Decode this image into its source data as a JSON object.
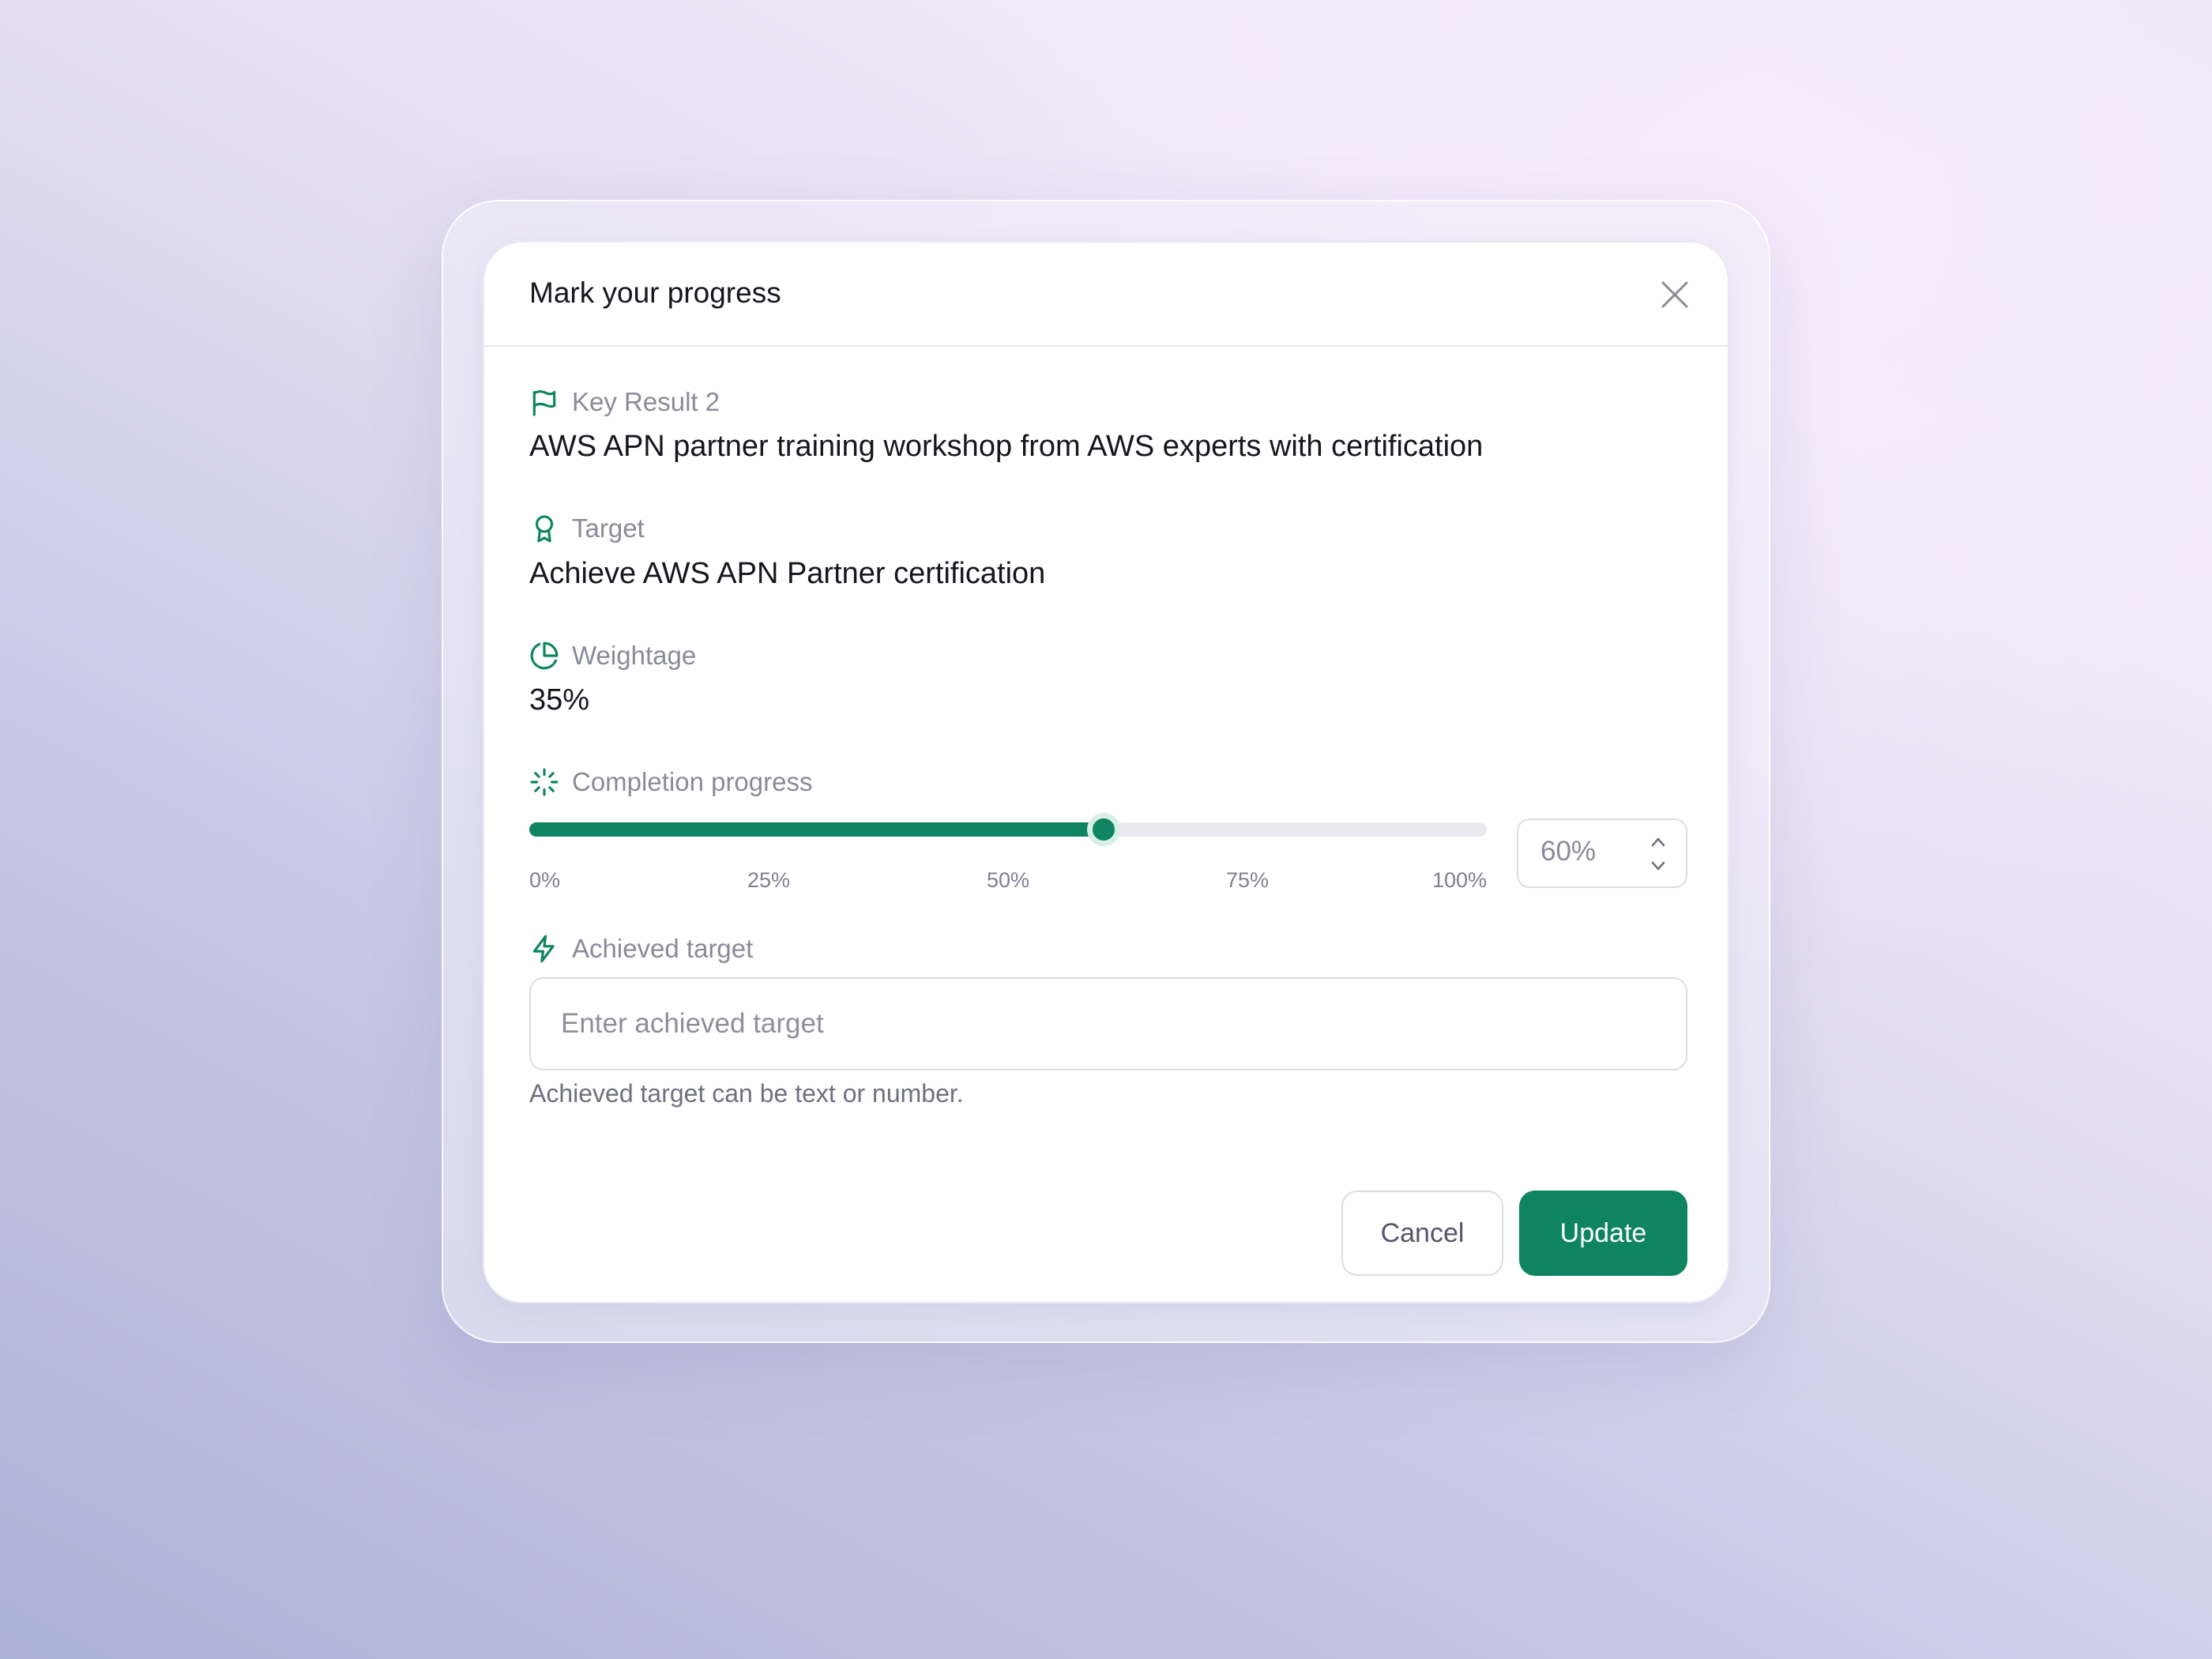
{
  "theme": {
    "accent": "#0f8460",
    "accent_soft": "#d7efe4",
    "text_primary": "#16161d",
    "text_muted": "#8a8b99"
  },
  "modal": {
    "title": "Mark your progress",
    "close_icon": "close-icon"
  },
  "key_result": {
    "icon": "flag-icon",
    "label": "Key Result 2",
    "value": "AWS APN partner training workshop from AWS experts with certification"
  },
  "target": {
    "icon": "award-icon",
    "label": "Target",
    "value": "Achieve AWS APN Partner certification"
  },
  "weightage": {
    "icon": "pie-chart-icon",
    "label": "Weightage",
    "value": "35%"
  },
  "completion": {
    "icon": "loader-icon",
    "label": "Completion progress",
    "progress_percent": 60,
    "ticks": [
      "0%",
      "25%",
      "50%",
      "75%",
      "100%"
    ],
    "stepper_value": "60%",
    "stepper_icons": [
      "chevron-up-icon",
      "chevron-down-icon"
    ]
  },
  "achieved_target": {
    "icon": "lightning-icon",
    "label": "Achieved target",
    "value": "",
    "placeholder": "Enter achieved target",
    "helper": "Achieved target can be text or number."
  },
  "actions": {
    "cancel_label": "Cancel",
    "update_label": "Update"
  }
}
